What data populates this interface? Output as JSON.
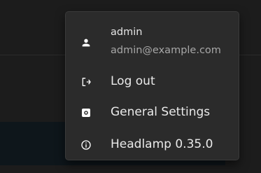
{
  "user_menu": {
    "username": "admin",
    "email": "admin@example.com",
    "items": [
      {
        "label": "Log out",
        "icon": "logout-icon"
      },
      {
        "label": "General Settings",
        "icon": "gear-icon"
      },
      {
        "label": "Headlamp 0.35.0",
        "icon": "info-icon"
      }
    ]
  }
}
